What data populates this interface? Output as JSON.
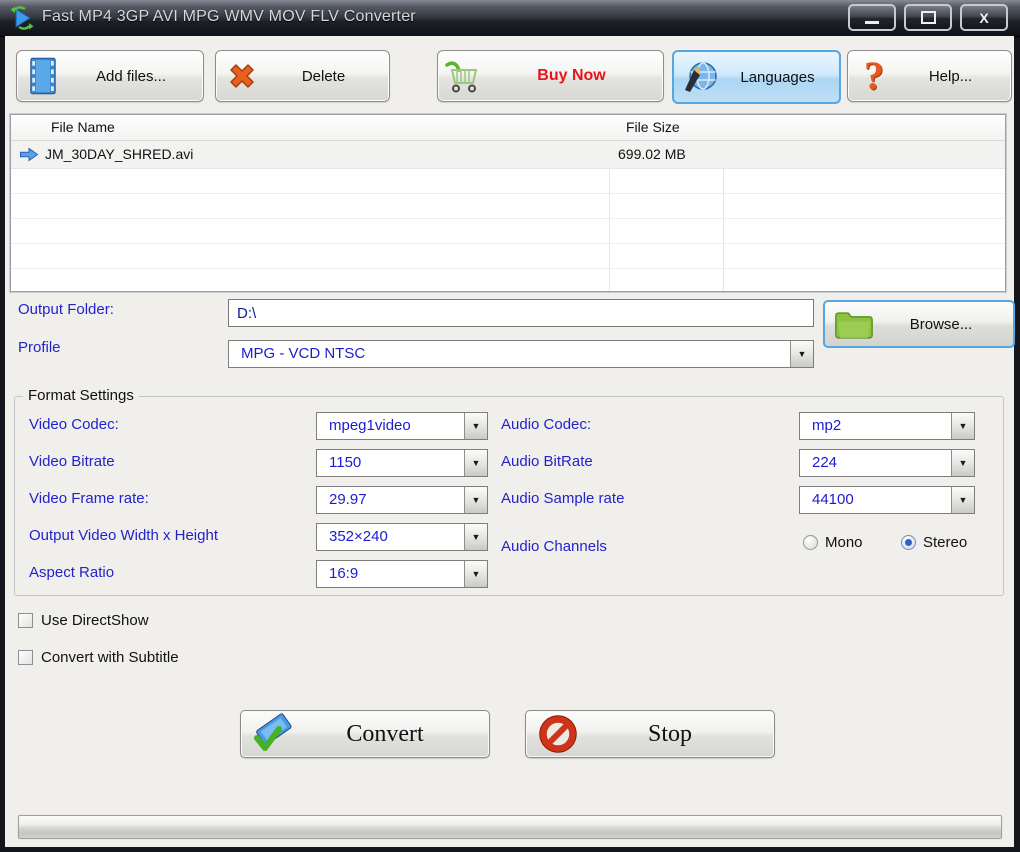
{
  "window": {
    "title": "Fast MP4 3GP AVI MPG WMV MOV FLV Converter"
  },
  "toolbar": {
    "add_files_label": "Add files...",
    "delete_label": "Delete",
    "buy_now_label": "Buy Now",
    "languages_label": "Languages",
    "help_label": "Help..."
  },
  "file_list": {
    "col_file_name": "File Name",
    "col_file_size": "File Size",
    "rows": [
      {
        "name": "JM_30DAY_SHRED.avi",
        "size": "699.02 MB"
      }
    ]
  },
  "output": {
    "folder_label": "Output Folder:",
    "folder_value": "D:\\",
    "browse_label": "Browse...",
    "profile_label": "Profile",
    "profile_value": "MPG - VCD NTSC"
  },
  "format_settings": {
    "legend": "Format Settings",
    "video_rows": [
      {
        "label": "Video Codec:",
        "value": "mpeg1video"
      },
      {
        "label": "Video Bitrate",
        "value": "1150"
      },
      {
        "label": "Video Frame rate:",
        "value": "29.97"
      },
      {
        "label": "Output Video Width x Height",
        "value": "352×240"
      },
      {
        "label": "Aspect Ratio",
        "value": "16:9"
      }
    ],
    "audio_rows": [
      {
        "label": "Audio Codec:",
        "value": "mp2"
      },
      {
        "label": "Audio BitRate",
        "value": "224"
      },
      {
        "label": "Audio Sample rate",
        "value": "44100"
      }
    ],
    "audio_channels_label": "Audio Channels",
    "mono_label": "Mono",
    "stereo_label": "Stereo",
    "selected_channel": "Stereo"
  },
  "options": {
    "use_directshow_label": "Use DirectShow",
    "convert_subtitle_label": "Convert with Subtitle"
  },
  "actions": {
    "convert_label": "Convert",
    "stop_label": "Stop"
  },
  "colors": {
    "label_blue": "#2323cc",
    "value_blue": "#1c1ccd",
    "buy_now_red": "#e8141c",
    "highlight_border": "#56a7e0",
    "titlebar_dark": "#14161c"
  }
}
